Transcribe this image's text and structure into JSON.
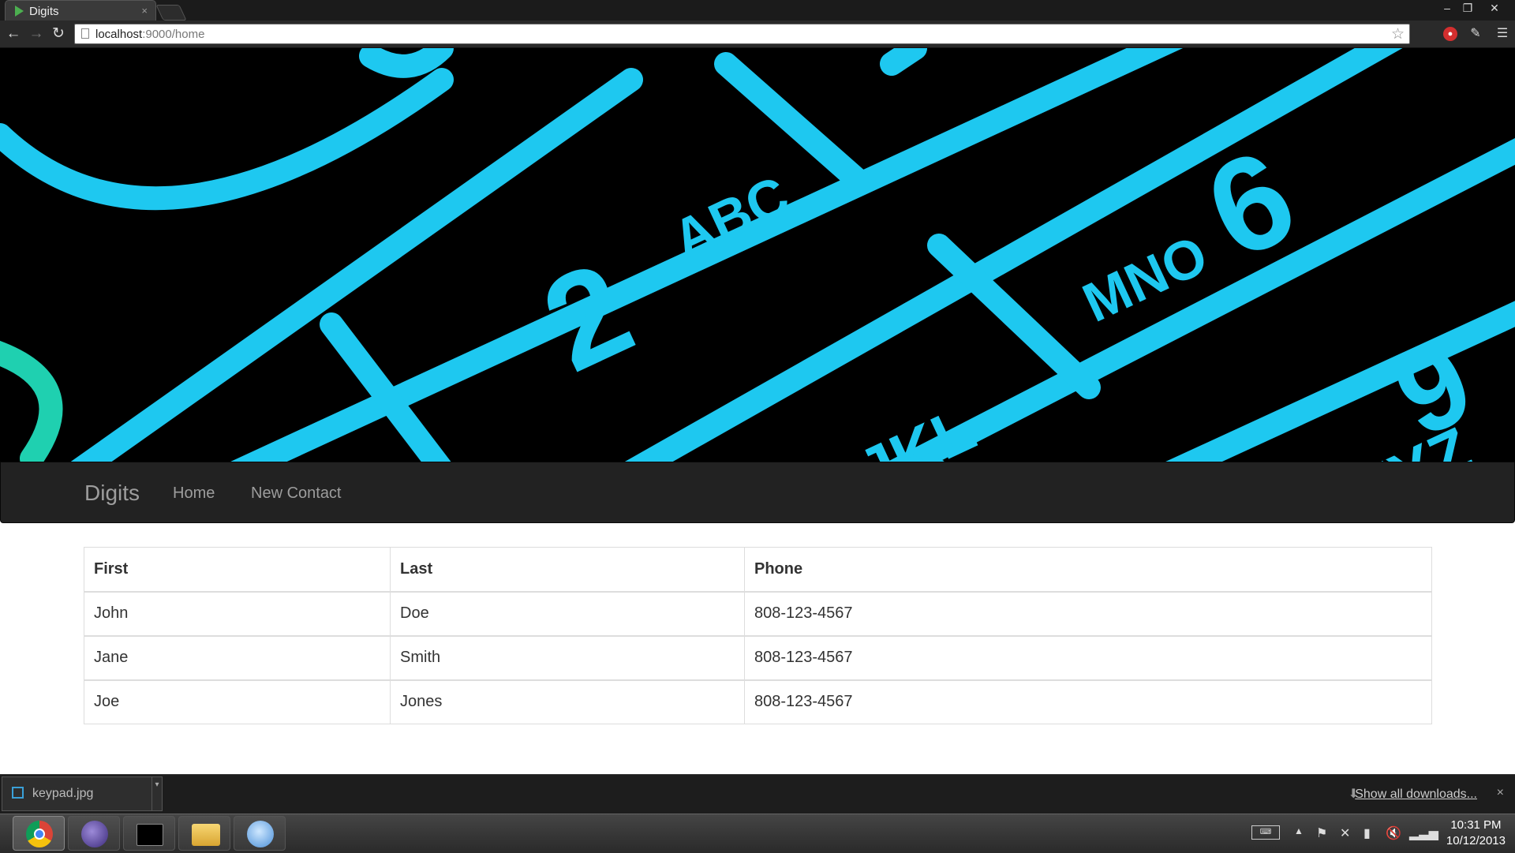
{
  "browser": {
    "tab_title": "Digits",
    "tab_close": "×",
    "url_host": "localhost",
    "url_rest": ":9000/home",
    "window_controls": [
      "–",
      "❐",
      "✕"
    ]
  },
  "hero": {
    "keypad_labels": [
      "2",
      "ABC",
      "MNO",
      "6",
      "JKL",
      "WXYZ",
      "9"
    ]
  },
  "navbar": {
    "brand": "Digits",
    "links": [
      "Home",
      "New Contact"
    ]
  },
  "table": {
    "headers": [
      "First",
      "Last",
      "Phone"
    ],
    "rows": [
      [
        "John",
        "Doe",
        "808-123-4567"
      ],
      [
        "Jane",
        "Smith",
        "808-123-4567"
      ],
      [
        "Joe",
        "Jones",
        "808-123-4567"
      ]
    ]
  },
  "downloads": {
    "file_name": "keypad.jpg",
    "show_all": "Show all downloads...",
    "close": "×"
  },
  "taskbar": {
    "apps": [
      "chrome-icon",
      "eclipse-icon",
      "terminal-icon",
      "folder-icon",
      "play-icon"
    ],
    "time": "10:31 PM",
    "date": "10/12/2013"
  },
  "colors": {
    "navbar_bg": "#222222",
    "navbar_text": "#9d9d9d",
    "keypad_glow": "#1ec8f0"
  }
}
